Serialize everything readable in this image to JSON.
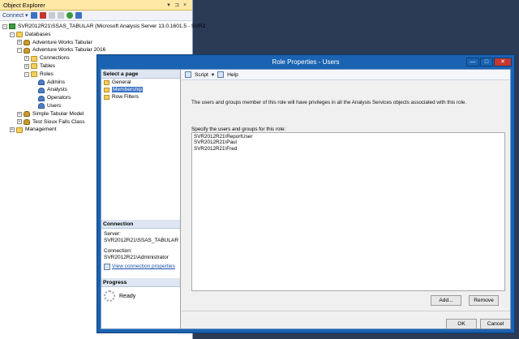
{
  "object_explorer": {
    "title": "Object Explorer",
    "title_controls": [
      "▾",
      "⊐",
      "×"
    ],
    "toolbar": {
      "connect_label": "Connect ▾"
    },
    "tree": [
      {
        "label": "SVR2012R21\\SSAS_TABULAR (Microsoft Analysis Server 13.0.1601.5 - SVR2",
        "icon": "server-icon",
        "expander": "−",
        "depth": 0
      },
      {
        "label": "Databases",
        "icon": "folder-icon",
        "expander": "−",
        "depth": 1
      },
      {
        "label": "Adventure Works Tabular",
        "icon": "database-icon",
        "expander": "+",
        "depth": 2
      },
      {
        "label": "Adventure Works Tabular 2016",
        "icon": "database-icon",
        "expander": "−",
        "depth": 2
      },
      {
        "label": "Connections",
        "icon": "folder-icon",
        "expander": "+",
        "depth": 3
      },
      {
        "label": "Tables",
        "icon": "folder-icon",
        "expander": "+",
        "depth": 3
      },
      {
        "label": "Roles",
        "icon": "folder-icon",
        "expander": "−",
        "depth": 3
      },
      {
        "label": "Admins",
        "icon": "role-icon",
        "expander": "",
        "depth": 4
      },
      {
        "label": "Analysts",
        "icon": "role-icon",
        "expander": "",
        "depth": 4
      },
      {
        "label": "Operators",
        "icon": "role-icon",
        "expander": "",
        "depth": 4
      },
      {
        "label": "Users",
        "icon": "role-icon",
        "expander": "",
        "depth": 4
      },
      {
        "label": "Simple Tabular Model",
        "icon": "database-icon",
        "expander": "+",
        "depth": 2
      },
      {
        "label": "Test Sioux Falls Class",
        "icon": "database-icon",
        "expander": "+",
        "depth": 2
      },
      {
        "label": "Management",
        "icon": "folder-icon",
        "expander": "+",
        "depth": 1
      }
    ]
  },
  "dialog": {
    "title": "Role Properties - Users",
    "window_buttons": [
      "—",
      "□",
      "✕"
    ],
    "select_page_header": "Select a page",
    "pages": [
      {
        "label": "General",
        "selected": false
      },
      {
        "label": "Membership",
        "selected": true
      },
      {
        "label": "Row Filters",
        "selected": false
      }
    ],
    "toolbar": {
      "script_label": "Script",
      "script_arrow": "▾",
      "help_label": "Help"
    },
    "description": "The users and groups member of this role will have privileges in all the Analysis Services objects associated with this role.",
    "members_label": "Specify the users and groups for this role:",
    "members": [
      "SVR2012R21\\ReportUser",
      "SVR2012R21\\Paul",
      "SVR2012R21\\Fred"
    ],
    "connection": {
      "header": "Connection",
      "server_label": "Server:",
      "server_value": "SVR2012R21\\SSAS_TABULAR",
      "connection_label": "Connection:",
      "connection_value": "SVR2012R21\\Administrator",
      "view_link": "View connection properties"
    },
    "progress": {
      "header": "Progress",
      "status": "Ready"
    },
    "buttons": {
      "add": "Add...",
      "remove": "Remove",
      "ok": "OK",
      "cancel": "Cancel"
    }
  },
  "colors": {
    "dialog_title_bar": "#1a63b2",
    "close_button": "#c7372f",
    "object_explorer_title": "#ffe8a6",
    "selection": "#3b72c4",
    "background": "#2b3a55"
  }
}
